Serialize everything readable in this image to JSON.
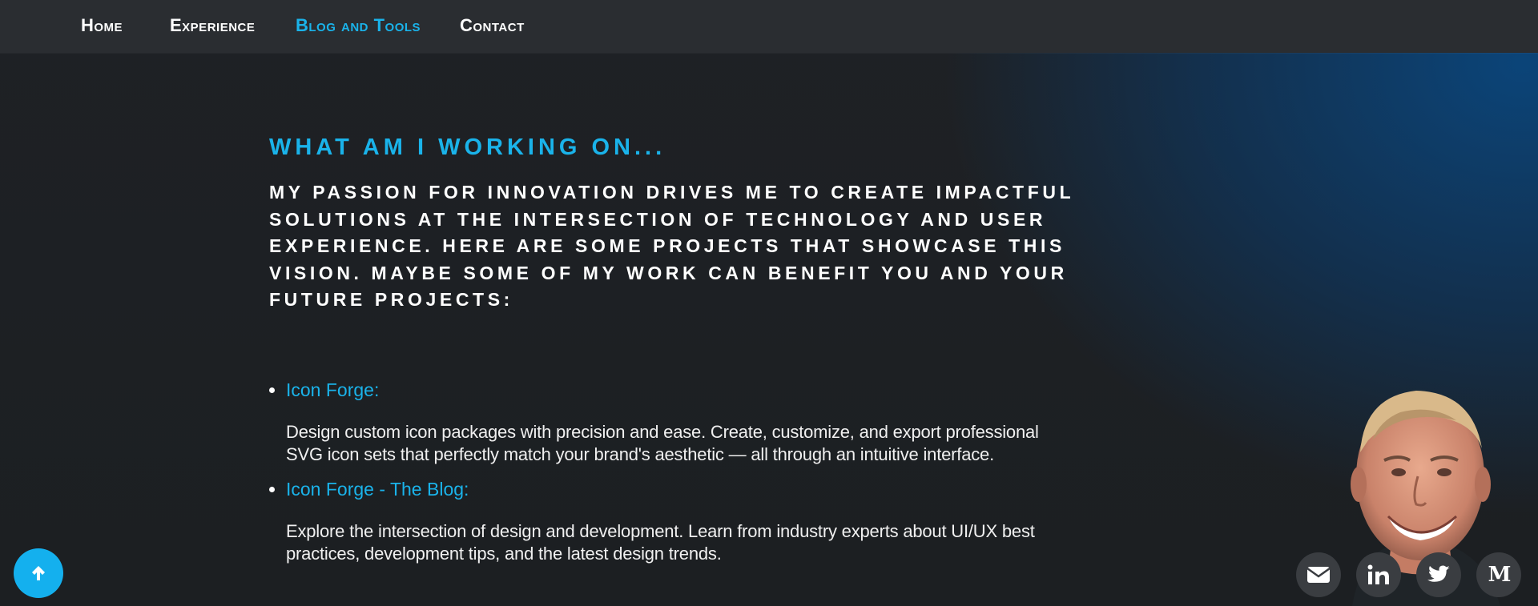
{
  "nav": {
    "items": [
      {
        "label": "Home",
        "active": false
      },
      {
        "label": "Experience",
        "active": false
      },
      {
        "label": "Blog and Tools",
        "active": true
      },
      {
        "label": "Contact",
        "active": false
      }
    ]
  },
  "main": {
    "title": "WHAT AM I WORKING ON...",
    "intro": "My passion for innovation drives me to create impactful solutions at the intersection of technology and user experience. Here are some projects that showcase this vision. Maybe some of my work can benefit you and your future projects:",
    "projects": [
      {
        "title": "Icon Forge:",
        "description": "Design custom icon packages with precision and ease. Create, customize, and export professional SVG icon sets that perfectly match your brand's aesthetic — all through an intuitive interface."
      },
      {
        "title": "Icon Forge - The Blog:",
        "description": "Explore the intersection of design and development. Learn from industry experts about UI/UX best practices, development tips, and the latest design trends."
      }
    ]
  },
  "social": {
    "items": [
      {
        "icon": "envelope-icon"
      },
      {
        "icon": "linkedin-icon",
        "label": "in"
      },
      {
        "icon": "twitter-icon"
      },
      {
        "icon": "medium-icon",
        "label": "M"
      }
    ]
  },
  "colors": {
    "accent": "#1ab3ea",
    "nav_bg": "#2a2d31",
    "scroll_button": "#14b0ee",
    "social_bg": "#3a3d41"
  }
}
